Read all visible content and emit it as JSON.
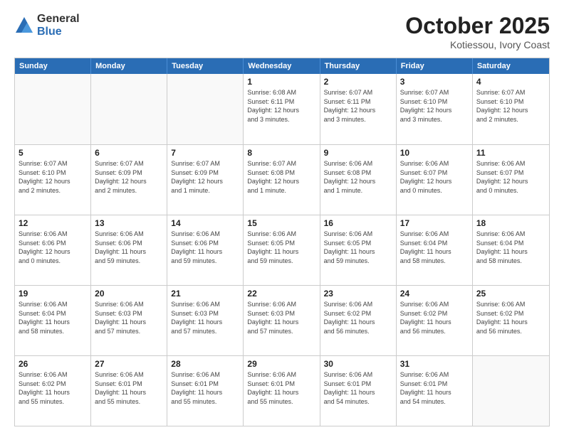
{
  "logo": {
    "general": "General",
    "blue": "Blue"
  },
  "header": {
    "month": "October 2025",
    "location": "Kotiessou, Ivory Coast"
  },
  "weekdays": [
    "Sunday",
    "Monday",
    "Tuesday",
    "Wednesday",
    "Thursday",
    "Friday",
    "Saturday"
  ],
  "weeks": [
    [
      {
        "day": "",
        "info": ""
      },
      {
        "day": "",
        "info": ""
      },
      {
        "day": "",
        "info": ""
      },
      {
        "day": "1",
        "info": "Sunrise: 6:08 AM\nSunset: 6:11 PM\nDaylight: 12 hours\nand 3 minutes."
      },
      {
        "day": "2",
        "info": "Sunrise: 6:07 AM\nSunset: 6:11 PM\nDaylight: 12 hours\nand 3 minutes."
      },
      {
        "day": "3",
        "info": "Sunrise: 6:07 AM\nSunset: 6:10 PM\nDaylight: 12 hours\nand 3 minutes."
      },
      {
        "day": "4",
        "info": "Sunrise: 6:07 AM\nSunset: 6:10 PM\nDaylight: 12 hours\nand 2 minutes."
      }
    ],
    [
      {
        "day": "5",
        "info": "Sunrise: 6:07 AM\nSunset: 6:10 PM\nDaylight: 12 hours\nand 2 minutes."
      },
      {
        "day": "6",
        "info": "Sunrise: 6:07 AM\nSunset: 6:09 PM\nDaylight: 12 hours\nand 2 minutes."
      },
      {
        "day": "7",
        "info": "Sunrise: 6:07 AM\nSunset: 6:09 PM\nDaylight: 12 hours\nand 1 minute."
      },
      {
        "day": "8",
        "info": "Sunrise: 6:07 AM\nSunset: 6:08 PM\nDaylight: 12 hours\nand 1 minute."
      },
      {
        "day": "9",
        "info": "Sunrise: 6:06 AM\nSunset: 6:08 PM\nDaylight: 12 hours\nand 1 minute."
      },
      {
        "day": "10",
        "info": "Sunrise: 6:06 AM\nSunset: 6:07 PM\nDaylight: 12 hours\nand 0 minutes."
      },
      {
        "day": "11",
        "info": "Sunrise: 6:06 AM\nSunset: 6:07 PM\nDaylight: 12 hours\nand 0 minutes."
      }
    ],
    [
      {
        "day": "12",
        "info": "Sunrise: 6:06 AM\nSunset: 6:06 PM\nDaylight: 12 hours\nand 0 minutes."
      },
      {
        "day": "13",
        "info": "Sunrise: 6:06 AM\nSunset: 6:06 PM\nDaylight: 11 hours\nand 59 minutes."
      },
      {
        "day": "14",
        "info": "Sunrise: 6:06 AM\nSunset: 6:06 PM\nDaylight: 11 hours\nand 59 minutes."
      },
      {
        "day": "15",
        "info": "Sunrise: 6:06 AM\nSunset: 6:05 PM\nDaylight: 11 hours\nand 59 minutes."
      },
      {
        "day": "16",
        "info": "Sunrise: 6:06 AM\nSunset: 6:05 PM\nDaylight: 11 hours\nand 59 minutes."
      },
      {
        "day": "17",
        "info": "Sunrise: 6:06 AM\nSunset: 6:04 PM\nDaylight: 11 hours\nand 58 minutes."
      },
      {
        "day": "18",
        "info": "Sunrise: 6:06 AM\nSunset: 6:04 PM\nDaylight: 11 hours\nand 58 minutes."
      }
    ],
    [
      {
        "day": "19",
        "info": "Sunrise: 6:06 AM\nSunset: 6:04 PM\nDaylight: 11 hours\nand 58 minutes."
      },
      {
        "day": "20",
        "info": "Sunrise: 6:06 AM\nSunset: 6:03 PM\nDaylight: 11 hours\nand 57 minutes."
      },
      {
        "day": "21",
        "info": "Sunrise: 6:06 AM\nSunset: 6:03 PM\nDaylight: 11 hours\nand 57 minutes."
      },
      {
        "day": "22",
        "info": "Sunrise: 6:06 AM\nSunset: 6:03 PM\nDaylight: 11 hours\nand 57 minutes."
      },
      {
        "day": "23",
        "info": "Sunrise: 6:06 AM\nSunset: 6:02 PM\nDaylight: 11 hours\nand 56 minutes."
      },
      {
        "day": "24",
        "info": "Sunrise: 6:06 AM\nSunset: 6:02 PM\nDaylight: 11 hours\nand 56 minutes."
      },
      {
        "day": "25",
        "info": "Sunrise: 6:06 AM\nSunset: 6:02 PM\nDaylight: 11 hours\nand 56 minutes."
      }
    ],
    [
      {
        "day": "26",
        "info": "Sunrise: 6:06 AM\nSunset: 6:02 PM\nDaylight: 11 hours\nand 55 minutes."
      },
      {
        "day": "27",
        "info": "Sunrise: 6:06 AM\nSunset: 6:01 PM\nDaylight: 11 hours\nand 55 minutes."
      },
      {
        "day": "28",
        "info": "Sunrise: 6:06 AM\nSunset: 6:01 PM\nDaylight: 11 hours\nand 55 minutes."
      },
      {
        "day": "29",
        "info": "Sunrise: 6:06 AM\nSunset: 6:01 PM\nDaylight: 11 hours\nand 55 minutes."
      },
      {
        "day": "30",
        "info": "Sunrise: 6:06 AM\nSunset: 6:01 PM\nDaylight: 11 hours\nand 54 minutes."
      },
      {
        "day": "31",
        "info": "Sunrise: 6:06 AM\nSunset: 6:01 PM\nDaylight: 11 hours\nand 54 minutes."
      },
      {
        "day": "",
        "info": ""
      }
    ]
  ]
}
